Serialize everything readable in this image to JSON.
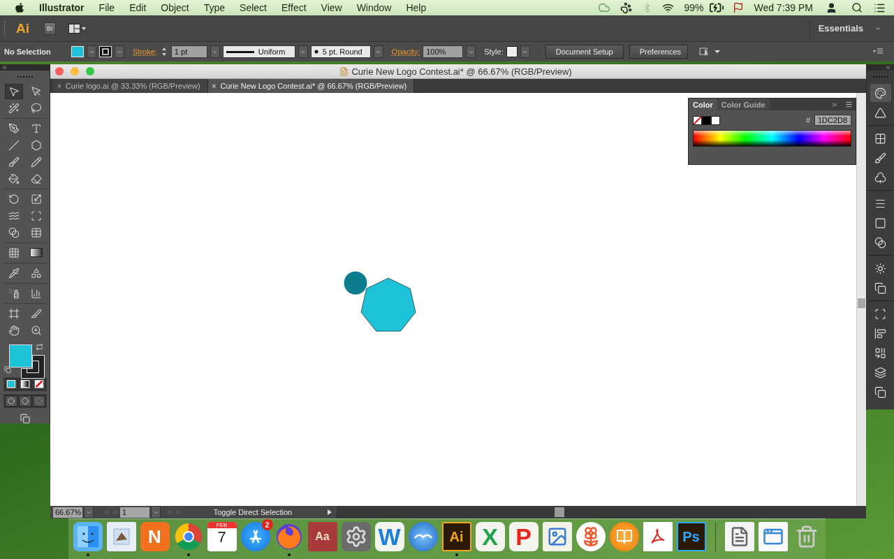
{
  "menu_bar": {
    "app_name": "Illustrator",
    "menus": [
      "File",
      "Edit",
      "Object",
      "Type",
      "Select",
      "Effect",
      "View",
      "Window",
      "Help"
    ],
    "battery": "99%",
    "clock": "Wed 7:39 PM"
  },
  "app_bar": {
    "logo": "Ai",
    "bridge": "Br",
    "workspace": "Essentials"
  },
  "control_bar": {
    "selection": "No Selection",
    "stroke_label": "Stroke:",
    "stroke_weight": "1 pt",
    "profile": "Uniform",
    "brush": "5 pt. Round",
    "opacity_label": "Opacity:",
    "opacity": "100%",
    "style_label": "Style:",
    "buttons": [
      "Document Setup",
      "Preferences"
    ]
  },
  "document": {
    "title": "Curie New Logo Contest.ai* @ 66.67% (RGB/Preview)",
    "tabs": [
      {
        "close": "×",
        "label": "Curie logo.ai @ 33.33% (RGB/Preview)",
        "selected": false
      },
      {
        "close": "×",
        "label": "Curie New Logo Contest.ai* @ 66.67% (RGB/Preview)",
        "selected": true
      }
    ]
  },
  "tools": [
    {
      "selected": true
    },
    {
      "selected": false
    },
    {
      "selected": false
    },
    {
      "selected": false
    },
    {
      "selected": false
    },
    {
      "selected": false
    },
    {
      "selected": false
    },
    {
      "selected": false
    },
    {
      "selected": false
    },
    {
      "selected": false
    },
    {
      "selected": false
    },
    {
      "selected": false
    },
    {
      "selected": false
    },
    {
      "selected": false
    },
    {
      "selected": false
    },
    {
      "selected": false
    },
    {
      "selected": false
    },
    {
      "selected": false
    },
    {
      "selected": false
    },
    {
      "selected": false
    },
    {
      "selected": false
    },
    {
      "selected": false
    },
    {
      "selected": false
    },
    {
      "selected": false
    },
    {
      "selected": false
    },
    {
      "selected": false
    },
    {
      "selected": false
    },
    {
      "selected": false
    }
  ],
  "color_panel": {
    "tabs": [
      {
        "label": "Color",
        "selected": true
      },
      {
        "label": "Color Guide",
        "selected": false
      }
    ],
    "hash": "#",
    "hex": "1DC2D8"
  },
  "status_bar": {
    "zoom": "66.67%",
    "artboard": "1",
    "message": "Toggle Direct Selection"
  },
  "dock": {
    "apps": [
      {
        "kind": "finder",
        "running": true
      },
      {
        "kind": "mail",
        "running": false
      },
      {
        "kind": "tile",
        "glyph": "N",
        "color": "#f3701e",
        "running": false
      },
      {
        "kind": "chrome",
        "running": true
      },
      {
        "kind": "calendar",
        "month": "FEB",
        "day": "7",
        "running": false
      },
      {
        "kind": "appstore",
        "badge": "2",
        "running": false
      },
      {
        "kind": "firefox",
        "running": true
      },
      {
        "kind": "dictionary",
        "glyph": "Aa",
        "running": false
      },
      {
        "kind": "settings",
        "running": false
      },
      {
        "kind": "letter",
        "glyph": "W",
        "color": "#1f7fd6",
        "running": false
      },
      {
        "kind": "gull",
        "running": false
      },
      {
        "kind": "adobe",
        "glyph": "Ai",
        "color": "#f7a21b",
        "running": true
      },
      {
        "kind": "letter",
        "glyph": "X",
        "color": "#1ea34a",
        "running": false
      },
      {
        "kind": "letter",
        "glyph": "P",
        "color": "#e8251f",
        "running": false
      },
      {
        "kind": "preview",
        "running": false
      },
      {
        "kind": "pinwheel",
        "running": false
      },
      {
        "kind": "book",
        "running": false
      },
      {
        "kind": "acrobat",
        "running": false
      },
      {
        "kind": "adobe",
        "glyph": "Ps",
        "color": "#31a8ff",
        "running": false
      },
      {
        "kind": "separator"
      },
      {
        "kind": "document",
        "running": false
      },
      {
        "kind": "window",
        "running": false
      },
      {
        "kind": "trash",
        "running": false
      }
    ]
  }
}
